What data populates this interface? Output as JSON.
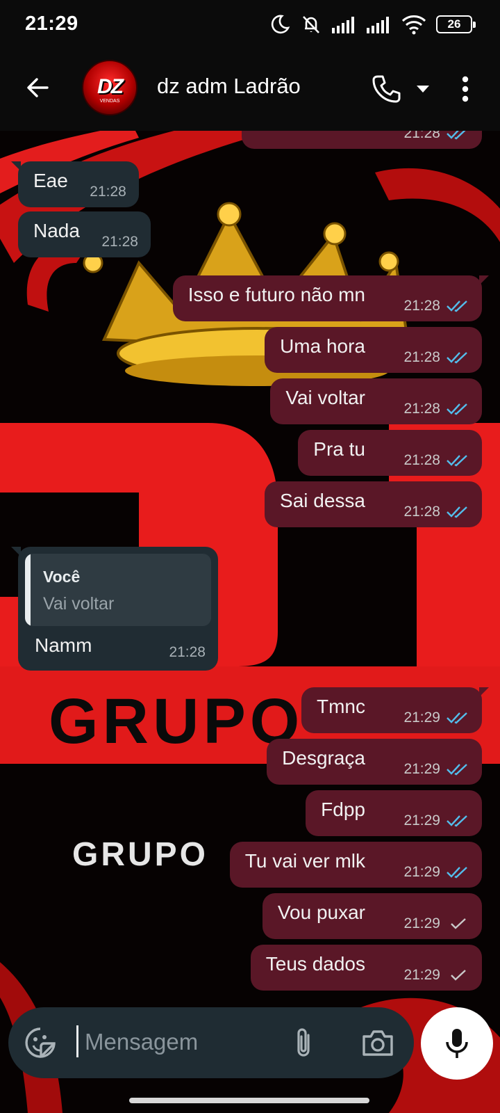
{
  "status_bar": {
    "time": "21:29",
    "battery": "26"
  },
  "header": {
    "contact_name": "dz adm Ladrão",
    "avatar_text": "DZ",
    "avatar_sub": "VENDAS"
  },
  "wallpaper": {
    "word_big": "GRUPO",
    "word_small": "GRUPO"
  },
  "messages": [
    {
      "direction": "out",
      "text": "",
      "time": "21:28",
      "ticks": "read"
    },
    {
      "direction": "in",
      "text": "Eae",
      "time": "21:28"
    },
    {
      "direction": "in",
      "text": "Nada",
      "time": "21:28"
    },
    {
      "direction": "out",
      "text": "Isso e futuro não mn",
      "time": "21:28",
      "ticks": "read"
    },
    {
      "direction": "out",
      "text": "Uma hora",
      "time": "21:28",
      "ticks": "read"
    },
    {
      "direction": "out",
      "text": "Vai voltar",
      "time": "21:28",
      "ticks": "read"
    },
    {
      "direction": "out",
      "text": "Pra tu",
      "time": "21:28",
      "ticks": "read"
    },
    {
      "direction": "out",
      "text": "Sai dessa",
      "time": "21:28",
      "ticks": "read"
    },
    {
      "direction": "in",
      "text": "Namm",
      "time": "21:28",
      "reply_to": {
        "author": "Você",
        "text": "Vai voltar"
      }
    },
    {
      "direction": "out",
      "text": "Tmnc",
      "time": "21:29",
      "ticks": "read"
    },
    {
      "direction": "out",
      "text": "Desgraça",
      "time": "21:29",
      "ticks": "read"
    },
    {
      "direction": "out",
      "text": "Fdpp",
      "time": "21:29",
      "ticks": "read"
    },
    {
      "direction": "out",
      "text": "Tu vai ver mlk",
      "time": "21:29",
      "ticks": "read"
    },
    {
      "direction": "out",
      "text": "Vou puxar",
      "time": "21:29",
      "ticks": "sent"
    },
    {
      "direction": "out",
      "text": "Teus dados",
      "time": "21:29",
      "ticks": "sent"
    }
  ],
  "composer": {
    "placeholder": "Mensagem"
  },
  "colors": {
    "outgoing_bubble": "#5a1727",
    "incoming_bubble": "#202c33",
    "read_tick": "#53bdeb",
    "sent_tick": "#c9c9c9"
  }
}
